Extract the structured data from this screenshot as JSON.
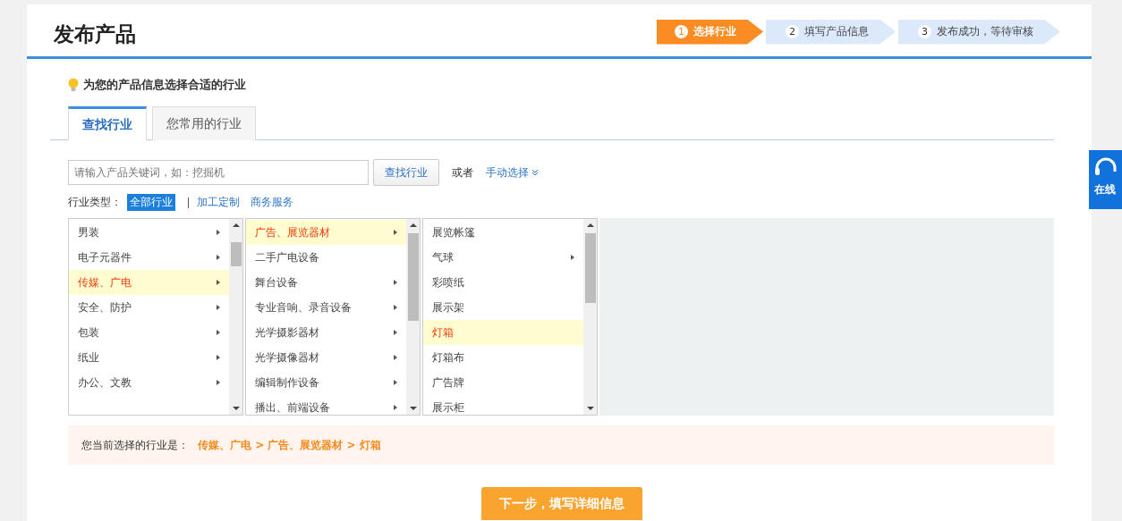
{
  "title": "发布产品",
  "steps": [
    {
      "number": "1",
      "label": "选择行业",
      "selected": true
    },
    {
      "number": "2",
      "label": "填写产品信息",
      "selected": false
    },
    {
      "number": "3",
      "label": "发布成功，等待审核",
      "selected": false
    }
  ],
  "hint": "为您的产品信息选择合适的行业",
  "tabs": [
    {
      "label": "查找行业",
      "selected": true
    },
    {
      "label": "您常用的行业",
      "selected": false
    }
  ],
  "search": {
    "placeholder": "请输入产品关键词，如：挖掘机",
    "button": "查找行业",
    "or": "或者",
    "manual": "手动选择"
  },
  "industry_type": {
    "label": "行业类型：",
    "options": [
      {
        "label": "全部行业",
        "selected": true
      },
      {
        "label": "加工定制",
        "selected": false
      },
      {
        "label": "商务服务",
        "selected": false
      }
    ]
  },
  "columns": [
    {
      "items": [
        {
          "label": "男装",
          "selected": false,
          "has_children": true
        },
        {
          "label": "电子元器件",
          "selected": false,
          "has_children": true
        },
        {
          "label": "传媒、广电",
          "selected": true,
          "has_children": true
        },
        {
          "label": "安全、防护",
          "selected": false,
          "has_children": true
        },
        {
          "label": "包装",
          "selected": false,
          "has_children": true
        },
        {
          "label": "纸业",
          "selected": false,
          "has_children": true
        },
        {
          "label": "办公、文教",
          "selected": false,
          "has_children": true
        }
      ]
    },
    {
      "items": [
        {
          "label": "广告、展览器材",
          "selected": true,
          "has_children": true
        },
        {
          "label": "二手广电设备",
          "selected": false,
          "has_children": false
        },
        {
          "label": "舞台设备",
          "selected": false,
          "has_children": true
        },
        {
          "label": "专业音响、录音设备",
          "selected": false,
          "has_children": true
        },
        {
          "label": "光学摄影器材",
          "selected": false,
          "has_children": true
        },
        {
          "label": "光学摄像器材",
          "selected": false,
          "has_children": true
        },
        {
          "label": "编辑制作设备",
          "selected": false,
          "has_children": true
        },
        {
          "label": "播出、前端设备",
          "selected": false,
          "has_children": true
        }
      ]
    },
    {
      "items": [
        {
          "label": "展览帐篷",
          "selected": false,
          "has_children": false
        },
        {
          "label": "气球",
          "selected": false,
          "has_children": true
        },
        {
          "label": "彩喷纸",
          "selected": false,
          "has_children": false
        },
        {
          "label": "展示架",
          "selected": false,
          "has_children": false
        },
        {
          "label": "灯箱",
          "selected": true,
          "has_children": false
        },
        {
          "label": "灯箱布",
          "selected": false,
          "has_children": false
        },
        {
          "label": "广告牌",
          "selected": false,
          "has_children": false
        },
        {
          "label": "展示柜",
          "selected": false,
          "has_children": false
        }
      ]
    }
  ],
  "current": {
    "label": "您当前选择的行业是：",
    "path": [
      "传媒、广电",
      "广告、展览器材",
      "灯箱"
    ],
    "separator": ">"
  },
  "next_button": "下一步，填写详细信息",
  "service": "在线"
}
